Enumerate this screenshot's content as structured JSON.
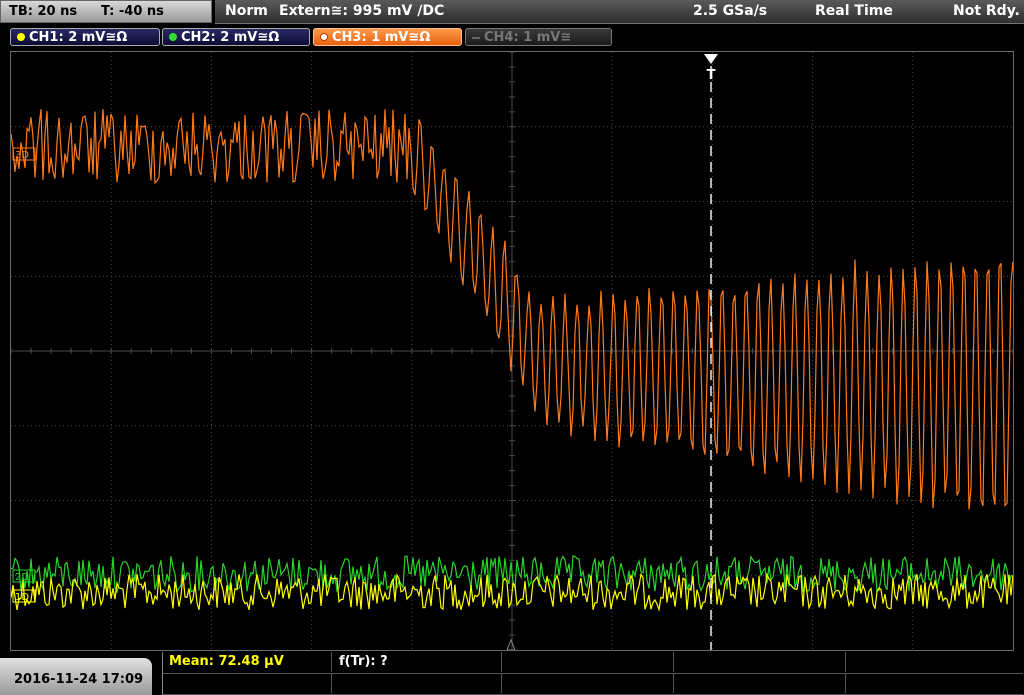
{
  "top": {
    "timebase": "TB: 20 ns",
    "trigger_time": "T: -40 ns",
    "acq_mode": "Norm",
    "trigger_source": "Extern≅: 995 mV ∕DC",
    "sample_rate": "2.5 GSa/s",
    "mode": "Real Time",
    "status": "Not Rdy."
  },
  "channels": [
    {
      "label": "CH1: 2 mV≅Ω",
      "color": "#ffff00",
      "active": true
    },
    {
      "label": "CH2: 2 mV≅Ω",
      "color": "#33dd33",
      "active": true
    },
    {
      "label": "CH3: 1 mV≅Ω",
      "color": "#ff7a1a",
      "active": true
    },
    {
      "label": "CH4: 1 mV≅",
      "color": "#777777",
      "active": false
    }
  ],
  "markers": {
    "trigger_marker": "T",
    "ch1_ref": "1D",
    "ch2_ref": "2D",
    "ch3_ref": "3D"
  },
  "bottom": {
    "datetime": "2016-11-24 17:09",
    "measurements": [
      {
        "label": "Mean: 72.48 µV",
        "color": "#ffff00"
      },
      {
        "label": "f(Tr): ?",
        "color": "#ffffff"
      }
    ]
  },
  "colors": {
    "ch1": "#ffff00",
    "ch2": "#2ad42a",
    "ch3": "#ff7a1a",
    "grid": "#4a4a4a"
  }
}
